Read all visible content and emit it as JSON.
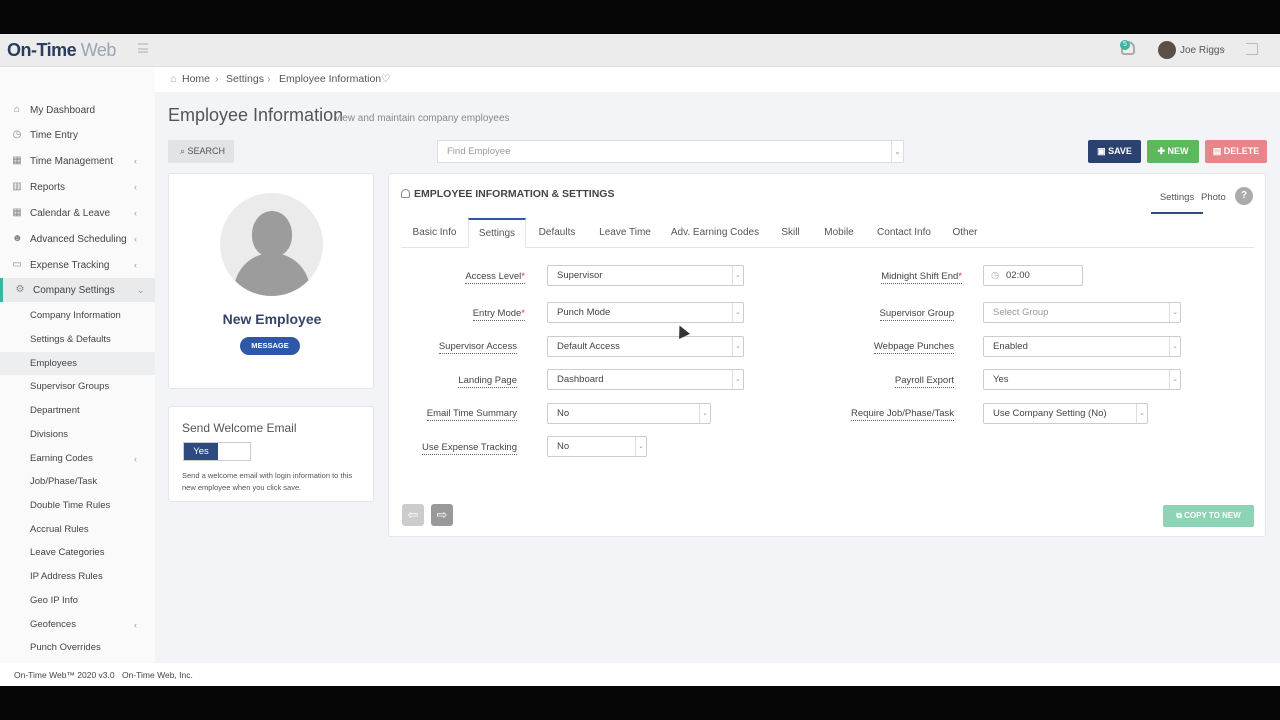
{
  "app": {
    "logo_main": "On-Time",
    "logo_web": "Web",
    "notification_count": "5",
    "user_name": "Joe Riggs"
  },
  "breadcrumb": {
    "home": "Home",
    "settings": "Settings",
    "current": "Employee Information"
  },
  "page": {
    "title": "Employee Information",
    "subtitle": "view and maintain company employees"
  },
  "sidebar": {
    "items": [
      {
        "label": "My Dashboard",
        "icon": "home-icon"
      },
      {
        "label": "Time Entry",
        "icon": "clock-icon"
      },
      {
        "label": "Time Management",
        "icon": "calendar-icon",
        "arrow": "‹"
      },
      {
        "label": "Reports",
        "icon": "chart-icon",
        "arrow": "‹"
      },
      {
        "label": "Calendar & Leave",
        "icon": "calendar-icon",
        "arrow": "‹"
      },
      {
        "label": "Advanced Scheduling",
        "icon": "users-icon",
        "arrow": "‹"
      },
      {
        "label": "Expense Tracking",
        "icon": "money-icon",
        "arrow": "‹"
      },
      {
        "label": "Company Settings",
        "icon": "cogs-icon",
        "arrow": "⌄"
      }
    ],
    "subitems": [
      {
        "label": "Company Information"
      },
      {
        "label": "Settings & Defaults"
      },
      {
        "label": "Employees"
      },
      {
        "label": "Supervisor Groups"
      },
      {
        "label": "Department"
      },
      {
        "label": "Divisions"
      },
      {
        "label": "Earning Codes",
        "arrow": "‹"
      },
      {
        "label": "Job/Phase/Task"
      },
      {
        "label": "Double Time Rules"
      },
      {
        "label": "Accrual Rules"
      },
      {
        "label": "Leave Categories"
      },
      {
        "label": "IP Address Rules"
      },
      {
        "label": "Geo IP Info"
      },
      {
        "label": "Geofences",
        "arrow": "‹"
      },
      {
        "label": "Punch Overrides"
      }
    ]
  },
  "toolbar": {
    "search_label": "SEARCH",
    "find_placeholder": "Find Employee",
    "save_label": "SAVE",
    "new_label": "NEW",
    "delete_label": "DELETE"
  },
  "profile": {
    "name": "New Employee",
    "message_label": "MESSAGE"
  },
  "welcome": {
    "title": "Send Welcome Email",
    "toggle_value": "Yes",
    "description": "Send a welcome email with login information to this new employee when you click save."
  },
  "panel": {
    "title": "EMPLOYEE INFORMATION & SETTINGS",
    "right_tabs": [
      "Settings",
      "Photo"
    ],
    "help": "?",
    "copy_label": "COPY TO NEW"
  },
  "tabs": [
    "Basic Info",
    "Settings",
    "Defaults",
    "Leave Time",
    "Adv. Earning Codes",
    "Skill",
    "Mobile",
    "Contact Info",
    "Other"
  ],
  "fields_left": [
    {
      "label": "Access Level",
      "required": true,
      "value": "Supervisor"
    },
    {
      "label": "Entry Mode",
      "required": true,
      "value": "Punch Mode"
    },
    {
      "label": "Supervisor Access",
      "value": "Default Access"
    },
    {
      "label": "Landing Page",
      "value": "Dashboard"
    },
    {
      "label": "Email Time Summary",
      "value": "No"
    },
    {
      "label": "Use Expense Tracking",
      "value": "No"
    }
  ],
  "fields_right": [
    {
      "label": "Midnight Shift End",
      "required": true,
      "value": "02:00"
    },
    {
      "label": "Supervisor Group",
      "placeholder": "Select Group"
    },
    {
      "label": "Webpage Punches",
      "value": "Enabled"
    },
    {
      "label": "Payroll Export",
      "value": "Yes"
    },
    {
      "label": "Require Job/Phase/Task",
      "value": "Use Company Setting (No)"
    }
  ],
  "footer": {
    "copyright": "On-Time Web™ 2020 v3.0",
    "company": "On-Time Web, Inc."
  },
  "colors": {
    "save": "#2b4170",
    "new": "#5cb85c",
    "delete": "#e6868a",
    "accent": "#3bb5a0"
  }
}
